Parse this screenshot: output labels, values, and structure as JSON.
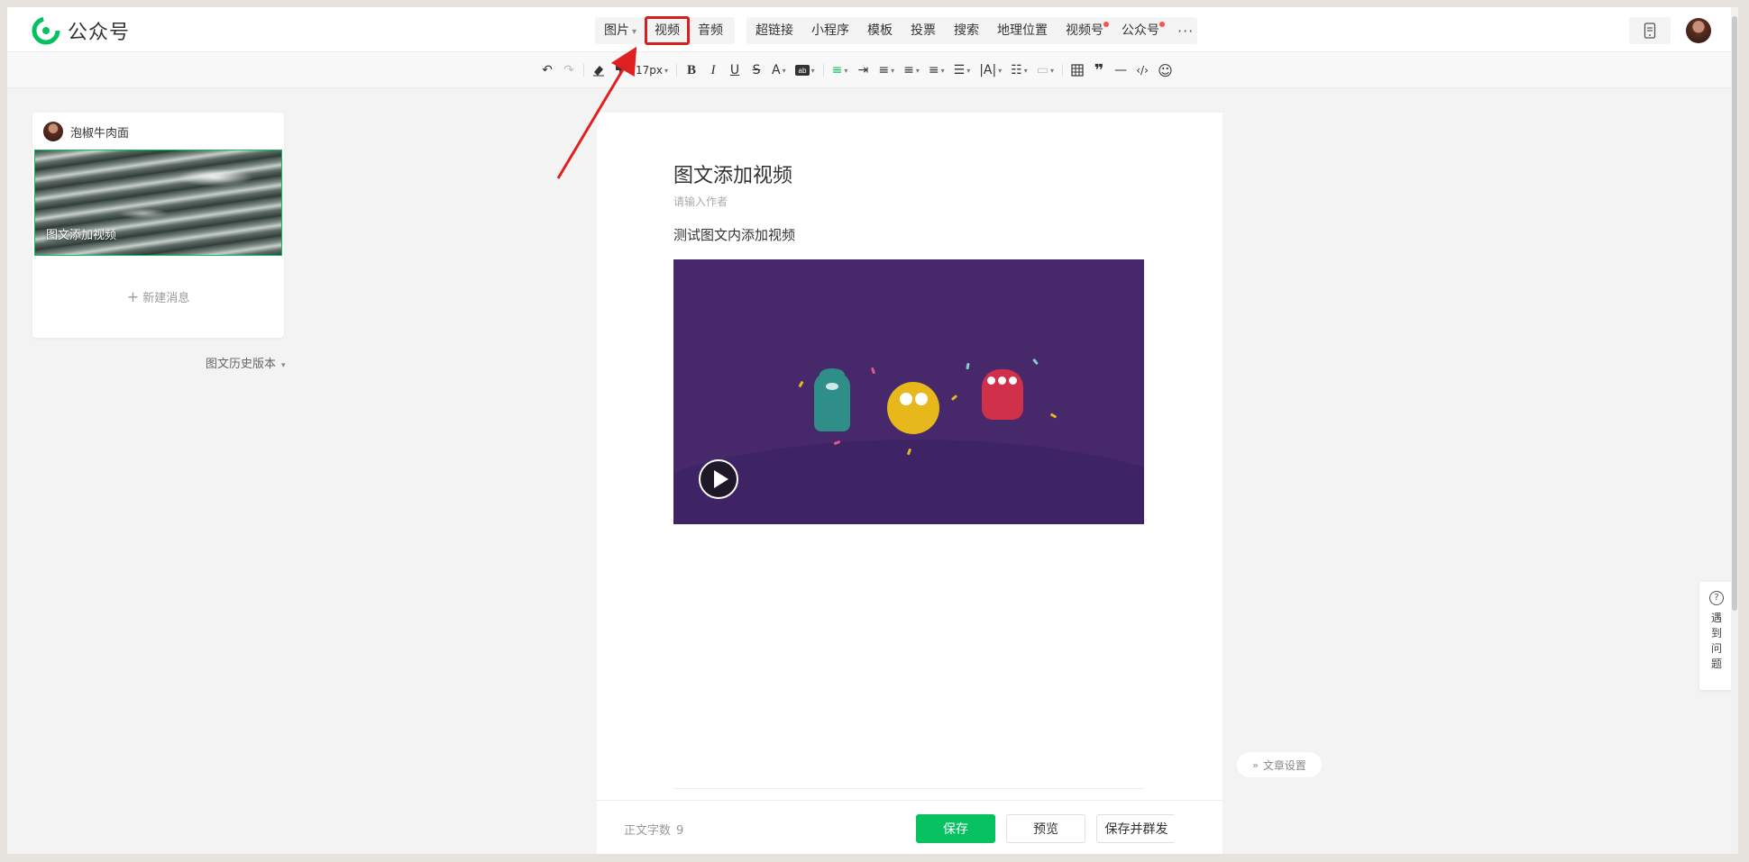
{
  "app": {
    "name": "公众号"
  },
  "insert_menu": {
    "group1": [
      {
        "label": "图片",
        "has_caret": true
      },
      {
        "label": "视频",
        "highlighted": true
      },
      {
        "label": "音频"
      }
    ],
    "group2": [
      {
        "label": "超链接"
      },
      {
        "label": "小程序"
      },
      {
        "label": "模板"
      },
      {
        "label": "投票"
      },
      {
        "label": "搜索"
      },
      {
        "label": "地理位置"
      },
      {
        "label": "视频号",
        "red_dot": true
      },
      {
        "label": "公众号",
        "red_dot": true
      }
    ],
    "more": "···"
  },
  "toolbar": {
    "font_size": "17px"
  },
  "sidebar": {
    "account_name": "泡椒牛肉面",
    "article_title": "图文添加视频",
    "new_message": "新建消息",
    "history": "图文历史版本"
  },
  "editor": {
    "title": "图文添加视频",
    "author_placeholder": "请输入作者",
    "body": "测试图文内添加视频"
  },
  "footer": {
    "word_count_label": "正文字数",
    "word_count": "9",
    "save": "保存",
    "preview": "预览",
    "save_send": "保存并群发"
  },
  "side": {
    "article_settings": "文章设置",
    "help": "遇到问题"
  },
  "colors": {
    "brand_green": "#07c160",
    "highlight_red": "#d61f1f",
    "video_bg": "#47296b"
  }
}
